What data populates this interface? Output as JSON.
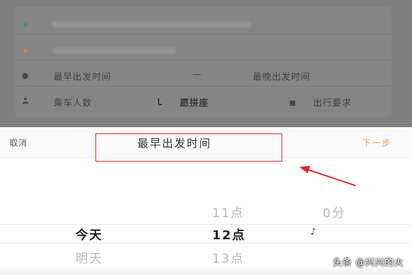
{
  "background_form": {
    "earliest_label": "最早出发时间",
    "dash": "—",
    "latest_label": "最晚出发时间",
    "passengers_label": "乘车人数",
    "carpool_label": "愿拼座",
    "requirements_label": "出行要求"
  },
  "picker": {
    "cancel_label": "取消",
    "title": "最早出发时间",
    "next_label": "下一步",
    "day_selected": "今天",
    "day_next": "明天",
    "hour_prev": "11点",
    "hour_selected": "12点",
    "hour_next": "13点",
    "minute_prev": "0分"
  },
  "watermark": "头条 @兴兴的火",
  "colors": {
    "next_accent": "#f39a3c",
    "annotation_red": "#e0262b",
    "dot_start": "#2e9e7a",
    "dot_end": "#e07a3a"
  }
}
